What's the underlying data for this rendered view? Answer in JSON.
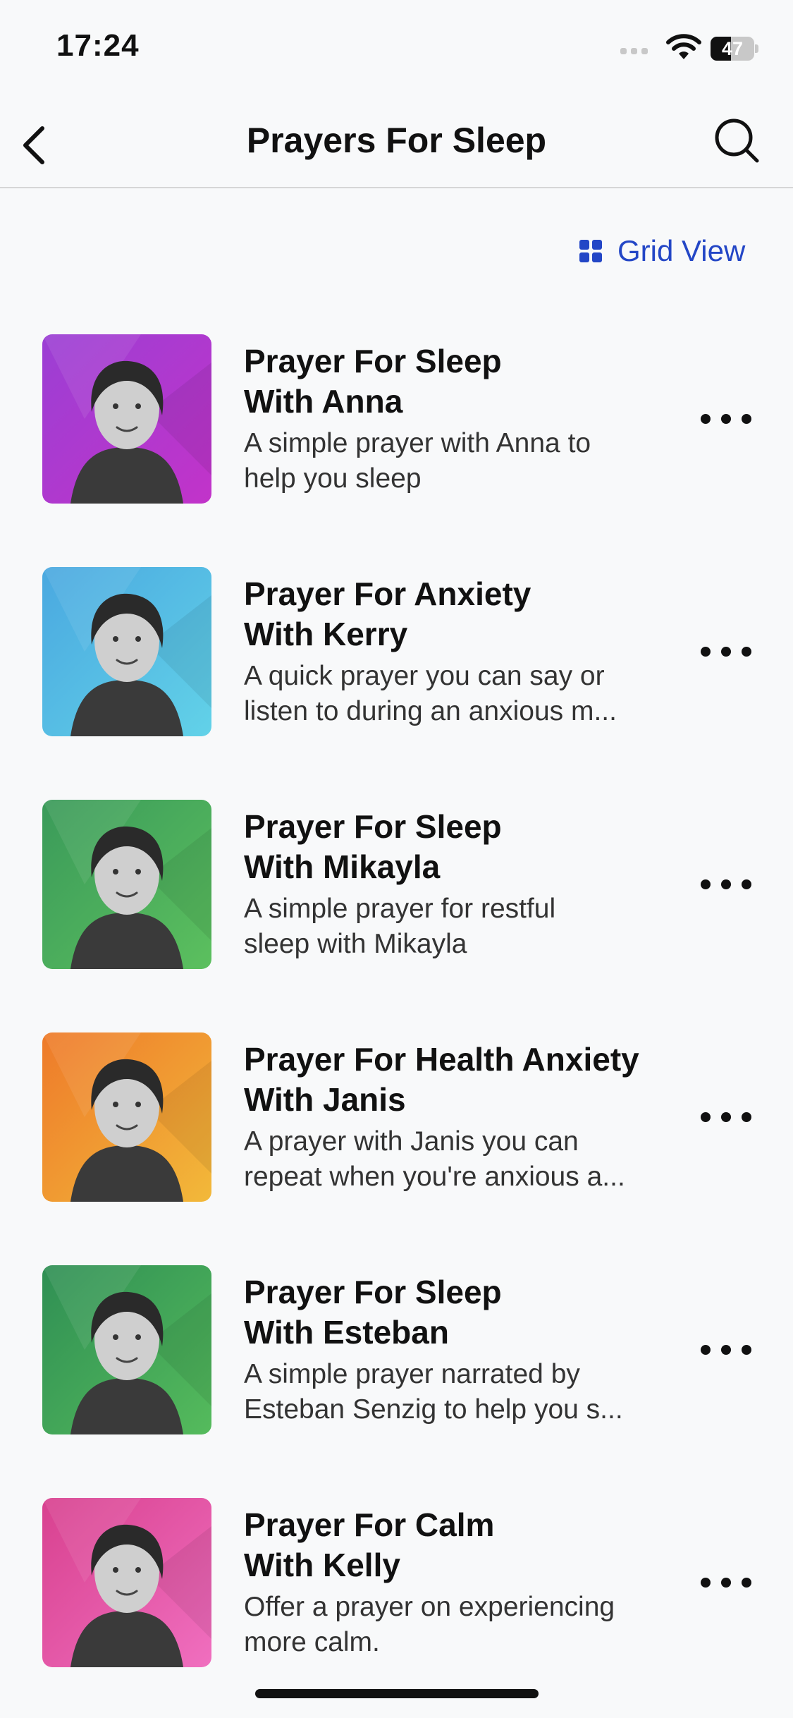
{
  "status": {
    "time": "17:24",
    "battery_level": "47"
  },
  "nav": {
    "title": "Prayers For Sleep",
    "back_icon": "chevron-left-icon",
    "search_icon": "search-icon"
  },
  "view_toggle": {
    "label": "Grid View",
    "icon": "grid-icon",
    "color": "#2346c6"
  },
  "items": [
    {
      "title_line1": "Prayer For Sleep",
      "title_line2": "With Anna",
      "desc_line1": "A simple prayer with Anna to",
      "desc_line2": "help you sleep",
      "thumb_colors": [
        "#9b3fd4",
        "#c233c9"
      ]
    },
    {
      "title_line1": "Prayer For Anxiety",
      "title_line2": "With Kerry",
      "desc_line1": "A quick prayer you can say or",
      "desc_line2": "listen to during an anxious m...",
      "thumb_colors": [
        "#4aa8e0",
        "#62d2e8"
      ]
    },
    {
      "title_line1": "Prayer For Sleep",
      "title_line2": "With Mikayla",
      "desc_line1": "A simple prayer for restful",
      "desc_line2": "sleep with Mikayla",
      "thumb_colors": [
        "#3a9a5a",
        "#5cc05e"
      ]
    },
    {
      "title_line1": "Prayer For Health Anxiety",
      "title_line2": "With Janis",
      "desc_line1": "A prayer with Janis you can",
      "desc_line2": "repeat when you're anxious a...",
      "thumb_colors": [
        "#ee7a2a",
        "#f2b93a"
      ]
    },
    {
      "title_line1": "Prayer For Sleep",
      "title_line2": "With Esteban",
      "desc_line1": "A simple prayer narrated by",
      "desc_line2": "Esteban Senzig to help you s...",
      "thumb_colors": [
        "#2f8f54",
        "#55bb5c"
      ]
    },
    {
      "title_line1": "Prayer For Calm",
      "title_line2": "With Kelly",
      "desc_line1": "Offer a prayer on experiencing",
      "desc_line2": "more calm.",
      "thumb_colors": [
        "#d8418f",
        "#f06fbf"
      ]
    }
  ]
}
